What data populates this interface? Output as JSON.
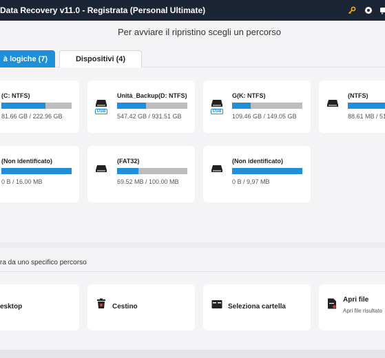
{
  "titlebar": {
    "title": "Data Recovery v11.0 - Registrata (Personal Ultimate)",
    "icons": [
      "key-icon",
      "settings-icon",
      "cart-icon"
    ]
  },
  "subtitle": "Per avviare il ripristino scegli un percorso",
  "tabs": [
    {
      "label": "à logiche (7)",
      "active": true
    },
    {
      "label": "Dispositivi (4)",
      "active": false
    }
  ],
  "drives": [
    {
      "name": "(C: NTFS)",
      "size": "81.66 GB / 222.96 GB",
      "usage": 0.37,
      "usb": false
    },
    {
      "name": "Unità_Backup(D: NTFS)",
      "size": "547.42 GB / 931.51 GB",
      "usage": 0.41,
      "usb": true
    },
    {
      "name": "G(K: NTFS)",
      "size": "109.46 GB / 149.05 GB",
      "usage": 0.26,
      "usb": true
    },
    {
      "name": "(NTFS)",
      "size": "88.61 MB / 51",
      "usage": 1.0,
      "usb": false
    },
    {
      "name": "(Non identificato)",
      "size": "0 B / 16.00 MB",
      "usage": 1.0,
      "usb": false
    },
    {
      "name": "(FAT32)",
      "size": "69.52 MB / 100.00 MB",
      "usage": 0.3,
      "usb": false
    },
    {
      "name": "(Non identificato)",
      "size": "0 B / 9,97 MB",
      "usage": 1.0,
      "usb": false
    }
  ],
  "locations": {
    "heading": "ra da uno specifico percorso",
    "items": [
      {
        "label": "esktop",
        "sub": ""
      },
      {
        "label": "Cestino",
        "sub": ""
      },
      {
        "label": "Seleziona cartella",
        "sub": ""
      },
      {
        "label": "Apri file",
        "sub": "Apri file risultato"
      }
    ]
  },
  "colors": {
    "accent": "#1e8fd8",
    "titlebar": "#1c2535",
    "bar_empty": "#bdbdbd"
  }
}
